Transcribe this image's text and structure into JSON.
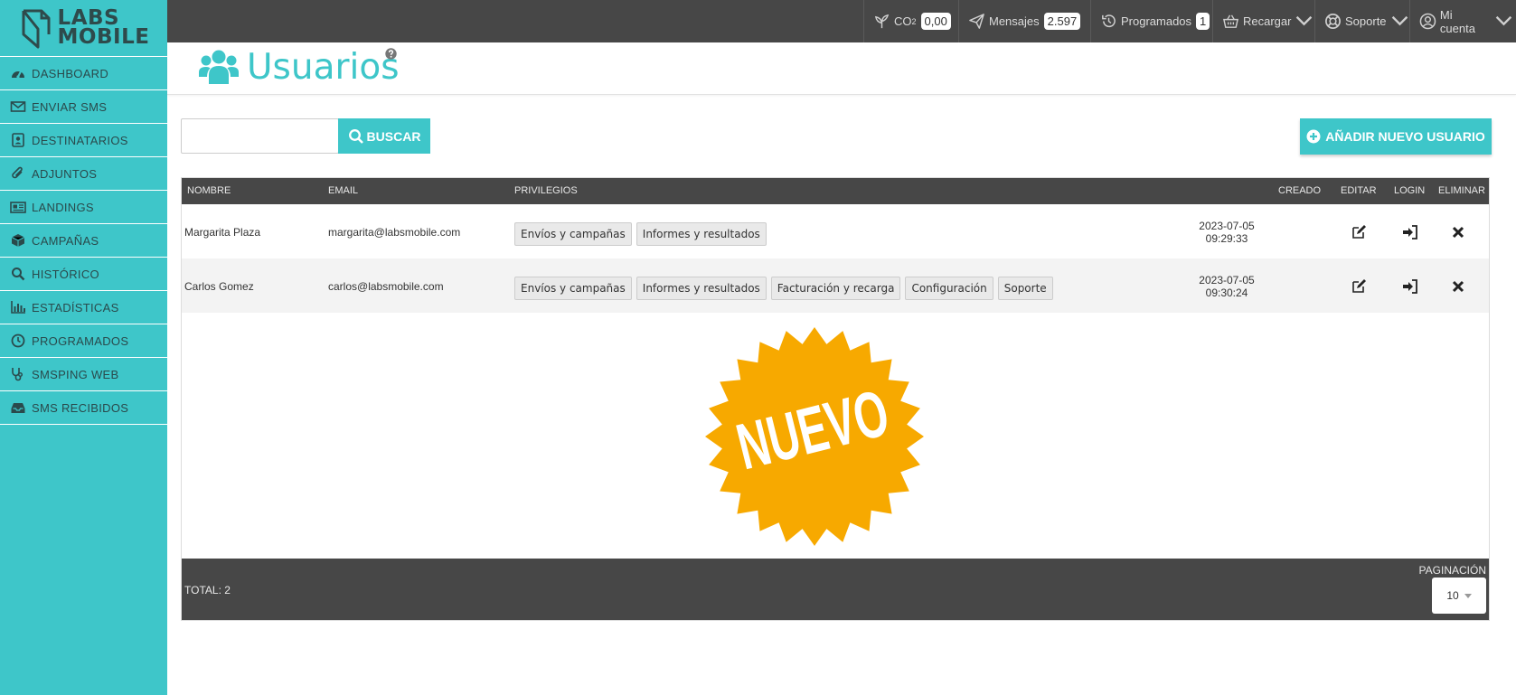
{
  "brand": {
    "line1": "LABS",
    "line2": "MOBILE",
    "accent": "#3ec6c9",
    "dark": "#474747",
    "badge_color": "#f7a900"
  },
  "sidebar": {
    "items": [
      {
        "label": "DASHBOARD",
        "icon": "dashboard-gauge-icon"
      },
      {
        "label": "ENVIAR SMS",
        "icon": "envelope-icon"
      },
      {
        "label": "DESTINATARIOS",
        "icon": "contact-book-icon"
      },
      {
        "label": "ADJUNTOS",
        "icon": "paperclip-icon"
      },
      {
        "label": "LANDINGS",
        "icon": "newspaper-icon"
      },
      {
        "label": "CAMPAÑAS",
        "icon": "cube-icon"
      },
      {
        "label": "HISTÓRICO",
        "icon": "search-icon"
      },
      {
        "label": "ESTADÍSTICAS",
        "icon": "bar-chart-icon"
      },
      {
        "label": "PROGRAMADOS",
        "icon": "clock-icon"
      },
      {
        "label": "SMSPING WEB",
        "icon": "stethoscope-icon"
      },
      {
        "label": "SMS RECIBIDOS",
        "icon": "inbox-icon"
      }
    ]
  },
  "topbar": {
    "co2_label": "CO",
    "co2_sub": "2",
    "co2_value": "0,00",
    "mensajes_label": "Mensajes",
    "mensajes_value": "2.597",
    "programados_label": "Programados",
    "programados_value": "1",
    "recargar_label": "Recargar",
    "soporte_label": "Soporte",
    "cuenta_label": "Mi cuenta"
  },
  "page": {
    "title": "Usuarios"
  },
  "search": {
    "placeholder": "",
    "button_label": "BUSCAR"
  },
  "add_button_label": "AÑADIR NUEVO USUARIO",
  "table": {
    "headers": {
      "name": "NOMBRE",
      "email": "EMAIL",
      "privileges": "PRIVILEGIOS",
      "created": "CREADO",
      "edit": "EDITAR",
      "login": "LOGIN",
      "delete": "ELIMINAR"
    },
    "rows": [
      {
        "name": "Margarita Plaza",
        "email": "margarita@labsmobile.com",
        "privileges": [
          "Envíos y campañas",
          "Informes y resultados"
        ],
        "created_date": "2023-07-05",
        "created_time": "09:29:33"
      },
      {
        "name": "Carlos Gomez",
        "email": "carlos@labsmobile.com",
        "privileges": [
          "Envíos y campañas",
          "Informes y resultados",
          "Facturación y recarga",
          "Configuración",
          "Soporte"
        ],
        "created_date": "2023-07-05",
        "created_time": "09:30:24"
      }
    ],
    "badge_text": "NUEVO",
    "total": "TOTAL: 2",
    "pagination_label": "PAGINACIÓN",
    "pagination_value": "10"
  }
}
